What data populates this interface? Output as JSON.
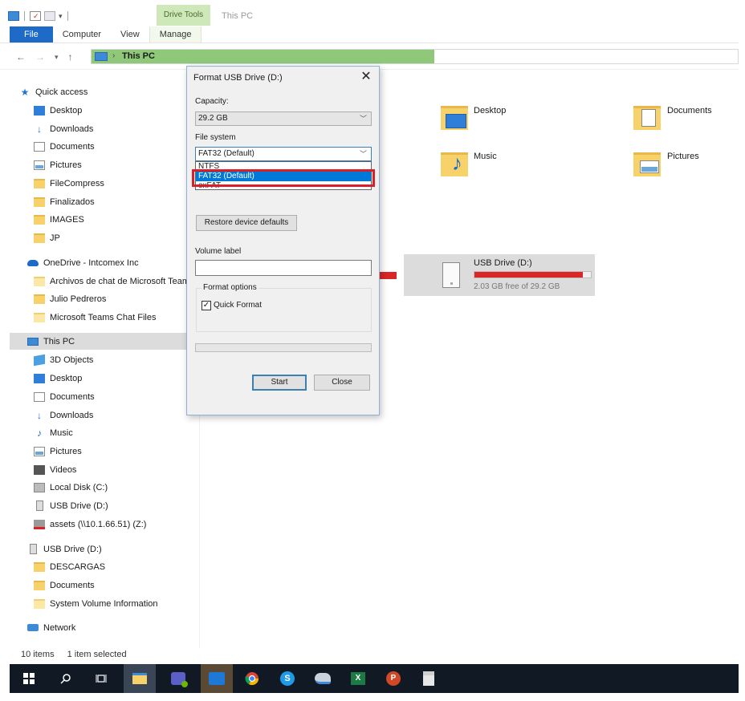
{
  "ribbon": {
    "context_tab": "Drive Tools",
    "window_title": "This PC",
    "tabs": [
      "File",
      "Computer",
      "View",
      "Manage"
    ]
  },
  "address": {
    "location": "This PC",
    "progress": 0.53
  },
  "sidebar": {
    "quick_access": "Quick access",
    "quick_items": [
      "Desktop",
      "Downloads",
      "Documents",
      "Pictures",
      "FileCompress",
      "Finalizados",
      "IMAGES",
      "JP"
    ],
    "onedrive": "OneDrive - Intcomex Inc",
    "onedrive_items": [
      "Archivos de chat de Microsoft Teams",
      "Julio Pedreros",
      "Microsoft Teams Chat Files"
    ],
    "this_pc": "This PC",
    "pc_items": [
      "3D Objects",
      "Desktop",
      "Documents",
      "Downloads",
      "Music",
      "Pictures",
      "Videos",
      "Local Disk (C:)",
      "USB Drive (D:)",
      "assets (\\\\10.1.66.51) (Z:)"
    ],
    "usb": "USB Drive (D:)",
    "usb_items": [
      "DESCARGAS",
      "Documents",
      "System Volume Information"
    ],
    "network": "Network"
  },
  "content": {
    "folders": [
      "Desktop",
      "Documents",
      "Music",
      "Pictures"
    ],
    "usb_drive": {
      "name": "USB Drive (D:)",
      "free_text": "2.03 GB free of 29.2 GB",
      "used_fraction": 0.93
    }
  },
  "status": {
    "items": "10 items",
    "selected": "1 item selected"
  },
  "dialog": {
    "title": "Format USB Drive (D:)",
    "capacity_label": "Capacity:",
    "capacity_value": "29.2 GB",
    "fs_label": "File system",
    "fs_value": "FAT32 (Default)",
    "fs_options": [
      "NTFS",
      "FAT32 (Default)",
      "exFAT"
    ],
    "restore_label": "Restore device defaults",
    "volume_label": "Volume label",
    "volume_value": "",
    "format_options_label": "Format options",
    "quick_format_label": "Quick Format",
    "quick_format_checked": true,
    "start_label": "Start",
    "close_label": "Close",
    "close_glyph": "✕"
  },
  "colors": {
    "accent": "#1e6ac9",
    "drive_bar": "#da2626",
    "highlight": "#d9202a",
    "selection": "#0078d7"
  }
}
